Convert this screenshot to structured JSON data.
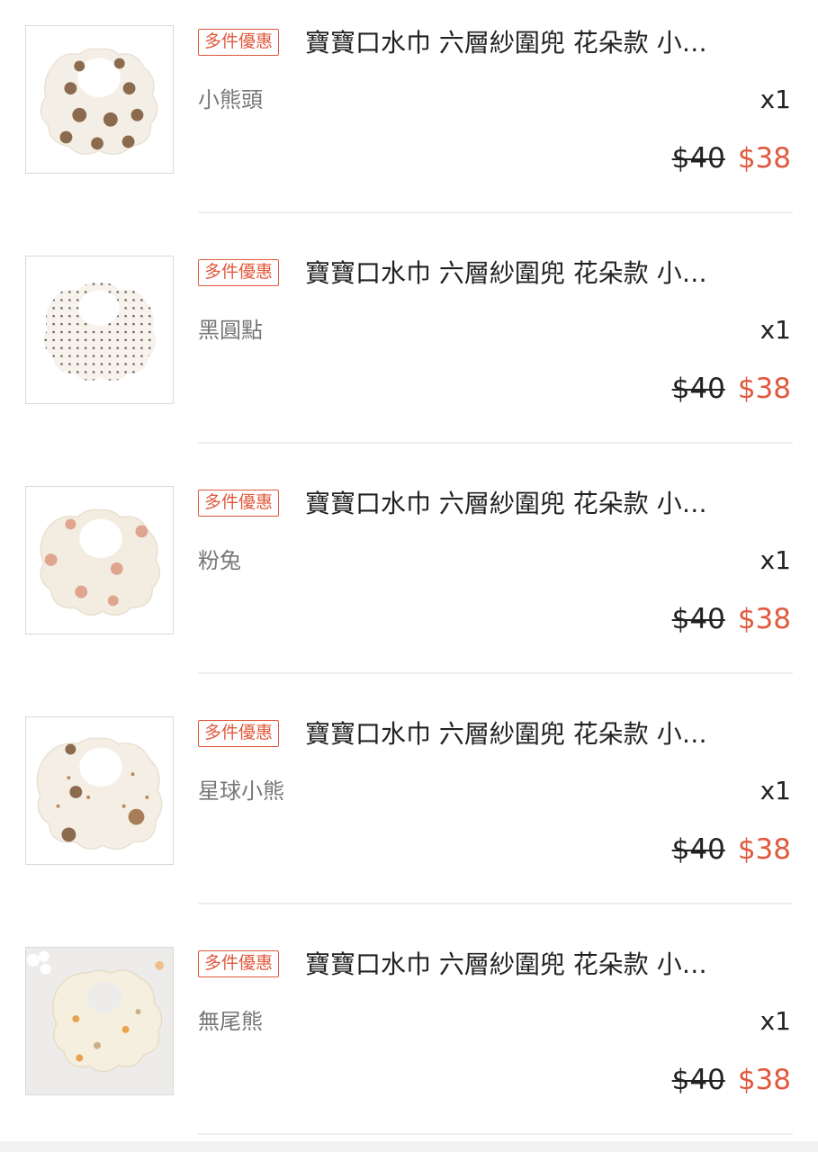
{
  "items": [
    {
      "badge": "多件優惠",
      "title": "寶寶口水巾 六層紗圍兜 花朵款 小…",
      "variant": "小熊頭",
      "qty": "x1",
      "old_price": "$40",
      "new_price": "$38",
      "image": "bib-bear-head"
    },
    {
      "badge": "多件優惠",
      "title": "寶寶口水巾 六層紗圍兜 花朵款 小…",
      "variant": "黑圓點",
      "qty": "x1",
      "old_price": "$40",
      "new_price": "$38",
      "image": "bib-black-dots"
    },
    {
      "badge": "多件優惠",
      "title": "寶寶口水巾 六層紗圍兜 花朵款 小…",
      "variant": "粉兔",
      "qty": "x1",
      "old_price": "$40",
      "new_price": "$38",
      "image": "bib-pink-rabbit"
    },
    {
      "badge": "多件優惠",
      "title": "寶寶口水巾 六層紗圍兜 花朵款 小…",
      "variant": "星球小熊",
      "qty": "x1",
      "old_price": "$40",
      "new_price": "$38",
      "image": "bib-planet-bear"
    },
    {
      "badge": "多件優惠",
      "title": "寶寶口水巾 六層紗圍兜 花朵款 小…",
      "variant": "無尾熊",
      "qty": "x1",
      "old_price": "$40",
      "new_price": "$38",
      "image": "bib-koala"
    }
  ],
  "colors": {
    "accent": "#e0593d",
    "text": "#222222",
    "muted": "#777777",
    "divider": "#eeeeee"
  }
}
